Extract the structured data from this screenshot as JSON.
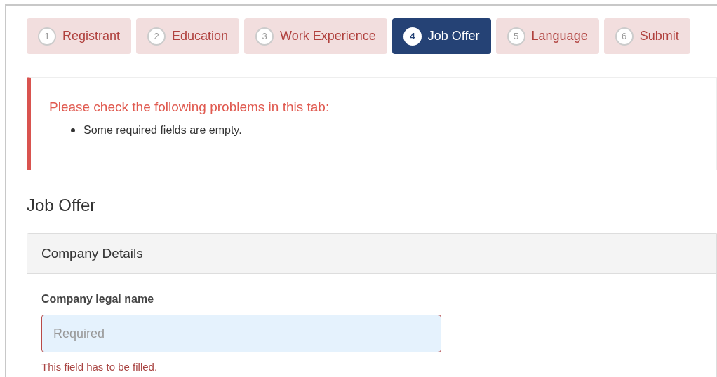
{
  "steps": [
    {
      "number": "1",
      "label": "Registrant",
      "selected": false
    },
    {
      "number": "2",
      "label": "Education",
      "selected": false
    },
    {
      "number": "3",
      "label": "Work Experience",
      "selected": false
    },
    {
      "number": "4",
      "label": "Job Offer",
      "selected": true
    },
    {
      "number": "5",
      "label": "Language",
      "selected": false
    },
    {
      "number": "6",
      "label": "Submit",
      "selected": false
    }
  ],
  "alert": {
    "title": "Please check the following problems in this tab:",
    "items": [
      "Some required fields are empty."
    ]
  },
  "heading": "Job Offer",
  "panel": {
    "title": "Company Details",
    "fields": [
      {
        "label": "Company legal name",
        "placeholder": "Required",
        "invalid": true,
        "error": "This field has to be filled."
      }
    ]
  }
}
